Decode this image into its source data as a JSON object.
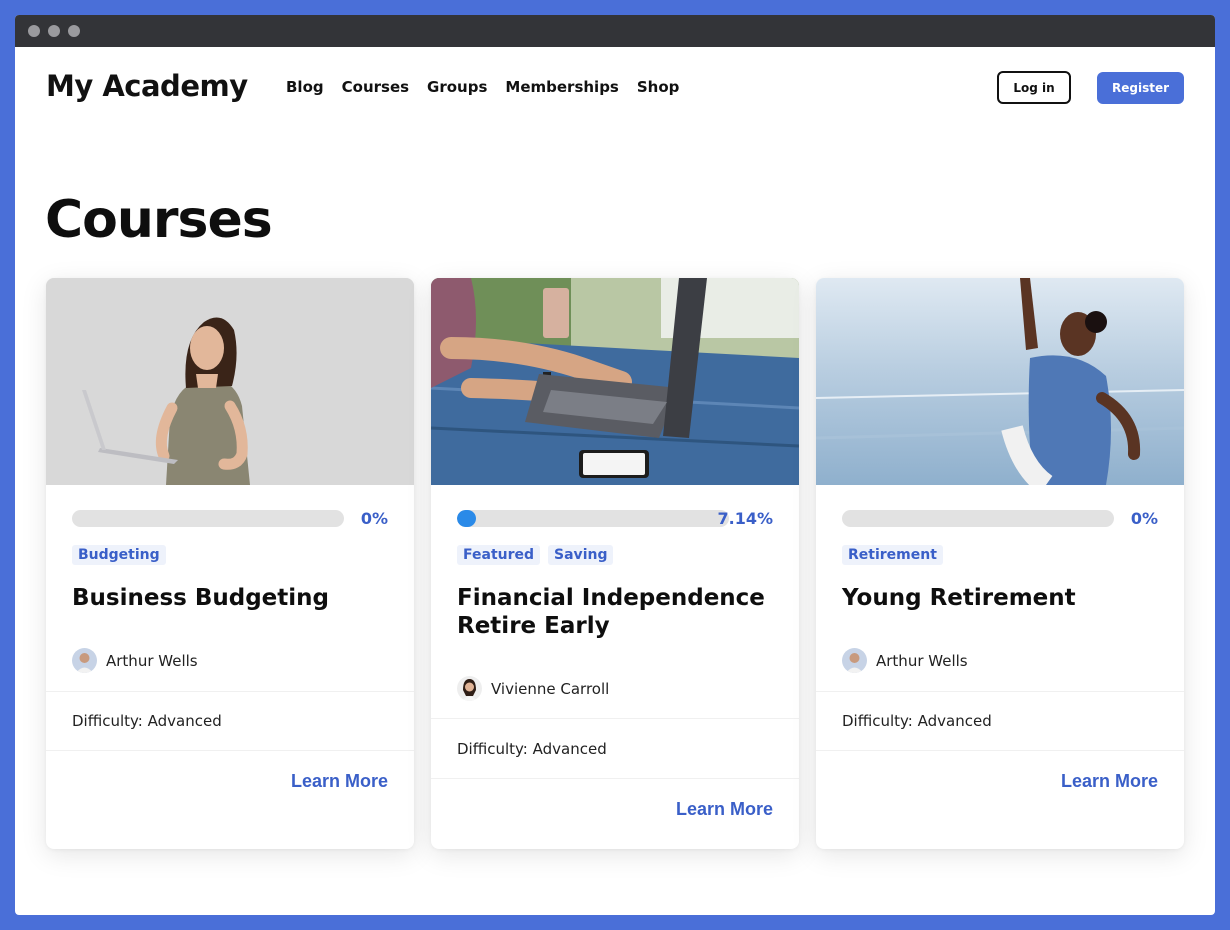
{
  "site": {
    "brand": "My Academy"
  },
  "nav": {
    "items": [
      "Blog",
      "Courses",
      "Groups",
      "Memberships",
      "Shop"
    ],
    "login_label": "Log in",
    "register_label": "Register"
  },
  "page": {
    "title": "Courses"
  },
  "colors": {
    "accent": "#4a6fd8",
    "link": "#3a5fc8",
    "progress_fill": "#2a8ae8"
  },
  "courses": [
    {
      "progress_label": "0%",
      "progress_fraction": 0,
      "tags": [
        "Budgeting"
      ],
      "title": "Business Budgeting",
      "author": "Arthur Wells",
      "difficulty": "Difficulty: Advanced",
      "cta": "Learn More"
    },
    {
      "progress_label": "7.14%",
      "progress_fraction": 0.0714,
      "tags": [
        "Featured",
        "Saving"
      ],
      "title": "Financial Independence Retire Early",
      "author": "Vivienne Carroll",
      "difficulty": "Difficulty: Advanced",
      "cta": "Learn More"
    },
    {
      "progress_label": "0%",
      "progress_fraction": 0,
      "tags": [
        "Retirement"
      ],
      "title": "Young Retirement",
      "author": "Arthur Wells",
      "difficulty": "Difficulty: Advanced",
      "cta": "Learn More"
    }
  ]
}
